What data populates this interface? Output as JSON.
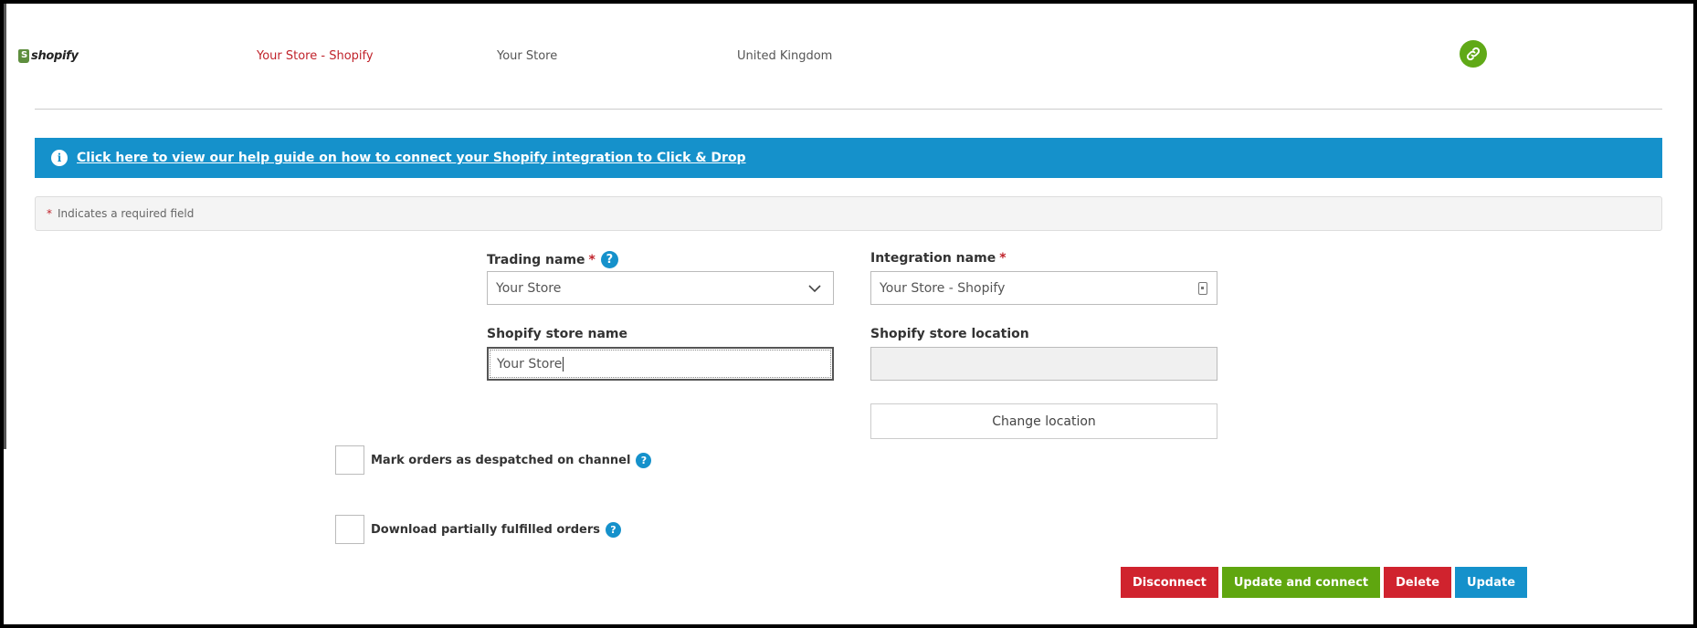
{
  "header": {
    "logo_text": "shopify",
    "integration_name": "Your Store - Shopify",
    "trading_name": "Your Store",
    "country": "United Kingdom",
    "status_icon": "link-icon",
    "status_color": "#60a917"
  },
  "banner": {
    "icon": "info-icon",
    "link_text": "Click here to view our help guide on how to connect your Shopify integration to Click & Drop"
  },
  "required_note": {
    "star": "*",
    "text": "Indicates a required field"
  },
  "form": {
    "trading_name": {
      "label": "Trading name",
      "required": "*",
      "help": "?",
      "value": "Your Store"
    },
    "integration_name": {
      "label": "Integration name",
      "required": "*",
      "value": "Your Store - Shopify"
    },
    "store_name": {
      "label": "Shopify store name",
      "value": "Your Store"
    },
    "store_location": {
      "label": "Shopify store location",
      "value": ""
    },
    "change_location_label": "Change location",
    "mark_despatched": {
      "label": "Mark orders as despatched on channel",
      "help": "?",
      "checked": false
    },
    "download_partial": {
      "label": "Download partially fulfilled orders",
      "help": "?",
      "checked": false
    }
  },
  "actions": {
    "disconnect": "Disconnect",
    "update_connect": "Update and connect",
    "delete": "Delete",
    "update": "Update"
  },
  "colors": {
    "accent_blue": "#1591cb",
    "danger_red": "#d0232e",
    "success_green": "#5fa60f"
  }
}
